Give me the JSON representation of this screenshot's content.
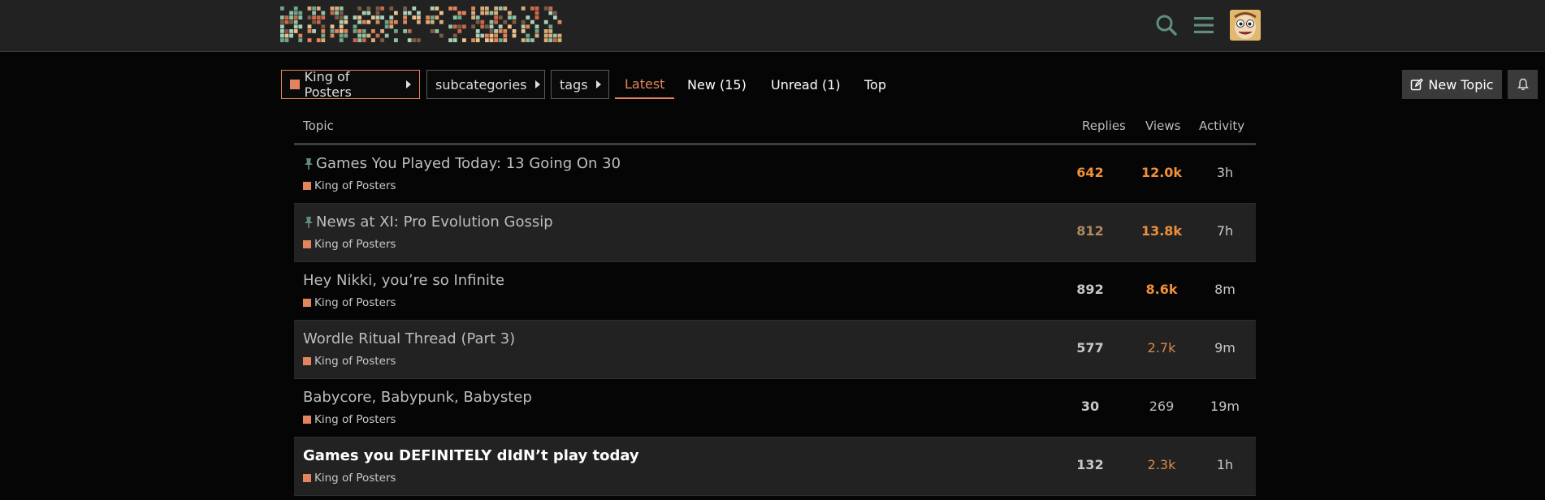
{
  "header": {
    "logo_icon": "pixel-mosaic-logo",
    "search_icon": "search-icon",
    "menu_icon": "hamburger-icon",
    "avatar_icon": "avatar"
  },
  "nav": {
    "category_label": "King of Posters",
    "subcategories_label": "subcategories",
    "tags_label": "tags",
    "latest_label": "Latest",
    "new_label": "New (15)",
    "unread_label": "Unread (1)",
    "top_label": "Top",
    "new_topic_label": "New Topic",
    "colors": {
      "accent": "#e8845a",
      "category": "#e4845f"
    }
  },
  "table": {
    "columns": {
      "topic": "Topic",
      "replies": "Replies",
      "views": "Views",
      "activity": "Activity"
    },
    "rows": [
      {
        "title": "Games You Played Today: 13 Going On 30",
        "pinned": true,
        "bold": false,
        "category": "King of Posters",
        "replies": "642",
        "replies_color": "#f0903a",
        "views": "12.0k",
        "views_color": "#f0903a",
        "views_bold": true,
        "activity": "3h"
      },
      {
        "title": "News at XI: Pro Evolution Gossip",
        "pinned": true,
        "bold": false,
        "category": "King of Posters",
        "replies": "812",
        "replies_color": "#b08a5e",
        "views": "13.8k",
        "views_color": "#f0903a",
        "views_bold": true,
        "activity": "7h"
      },
      {
        "title": "Hey Nikki, you’re so Infinite",
        "pinned": false,
        "bold": false,
        "category": "King of Posters",
        "replies": "892",
        "replies_color": "#c8c8c8",
        "views": "8.6k",
        "views_color": "#f0903a",
        "views_bold": true,
        "activity": "8m"
      },
      {
        "title": "Wordle Ritual Thread (Part 3)",
        "pinned": false,
        "bold": false,
        "category": "King of Posters",
        "replies": "577",
        "replies_color": "#c8c8c8",
        "views": "2.7k",
        "views_color": "#d98a4a",
        "views_bold": false,
        "activity": "9m"
      },
      {
        "title": "Babycore, Babypunk, Babystep",
        "pinned": false,
        "bold": false,
        "category": "King of Posters",
        "replies": "30",
        "replies_color": "#c8c8c8",
        "views": "269",
        "views_color": "#bdbdbd",
        "views_bold": false,
        "activity": "19m"
      },
      {
        "title": "Games you DEFINITELY dIdN’t play today",
        "pinned": false,
        "bold": true,
        "category": "King of Posters",
        "replies": "132",
        "replies_color": "#c8c8c8",
        "views": "2.3k",
        "views_color": "#d98a4a",
        "views_bold": false,
        "activity": "1h"
      }
    ]
  }
}
